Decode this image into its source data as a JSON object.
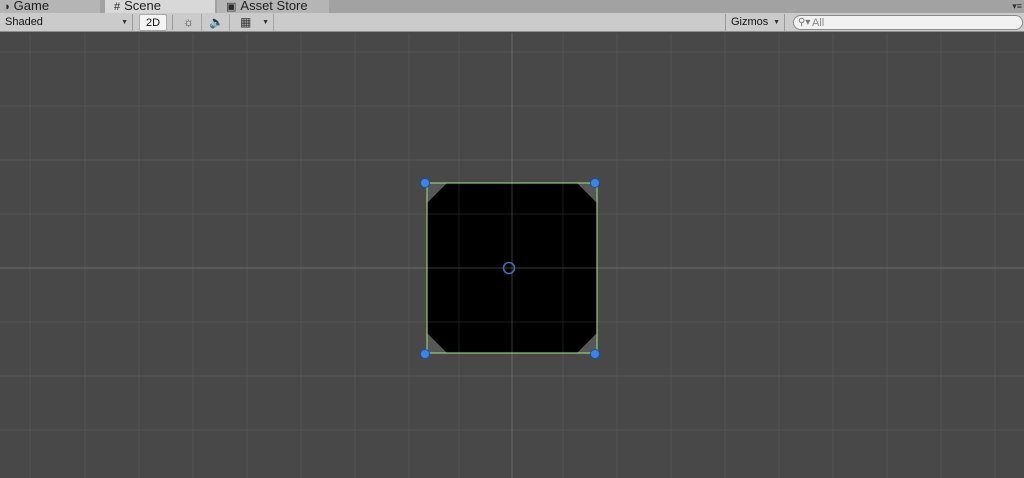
{
  "tabs": [
    {
      "label": "Game",
      "icon": "pacman-icon"
    },
    {
      "label": "Scene",
      "icon": "grid-icon"
    },
    {
      "label": "Asset Store",
      "icon": "bag-icon"
    }
  ],
  "toolbar": {
    "shading_mode": "Shaded",
    "mode_2d_label": "2D",
    "lighting_icon": "sun-icon",
    "audio_icon": "speaker-icon",
    "effects_icon": "image-icon",
    "gizmos_label": "Gizmos",
    "search_placeholder": "All"
  },
  "colors": {
    "scene_background": "#484848",
    "grid_line": "#555555",
    "selection_outline": "#8fcf74",
    "handle": "#3a86e6",
    "sprite": "#000000"
  }
}
